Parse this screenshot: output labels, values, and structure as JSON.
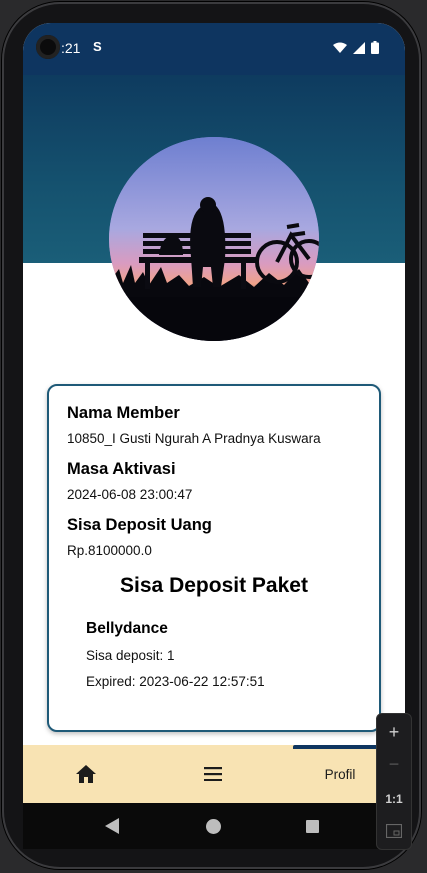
{
  "status_bar": {
    "time": ":21",
    "notification_glyph": "S",
    "icons": [
      "wifi-icon",
      "signal-icon",
      "battery-icon"
    ]
  },
  "profile": {
    "avatar_icon": "profile-photo"
  },
  "member": {
    "name_label": "Nama Member",
    "name_value": "10850_I Gusti Ngurah A Pradnya Kuswara",
    "activation_label": "Masa Aktivasi",
    "activation_value": "2024-06-08 23:00:47",
    "deposit_label": "Sisa Deposit Uang",
    "deposit_value": "Rp.8100000.0"
  },
  "package_section": {
    "title": "Sisa Deposit Paket",
    "items": [
      {
        "name": "Bellydance",
        "remaining": "Sisa deposit: 1",
        "expired": "Expired: 2023-06-22 12:57:51"
      }
    ]
  },
  "bottom_nav": {
    "home_icon": "home-icon",
    "menu_icon": "menu-icon",
    "profile_label": "Profil"
  },
  "zoom_controls": {
    "zoom_in": "+",
    "zoom_out": "−",
    "ratio": "1:1"
  },
  "colors": {
    "header": "#0e3560",
    "band": "#15526f",
    "card_border": "#1f5a78",
    "bottom_nav": "#f8e3b3"
  }
}
